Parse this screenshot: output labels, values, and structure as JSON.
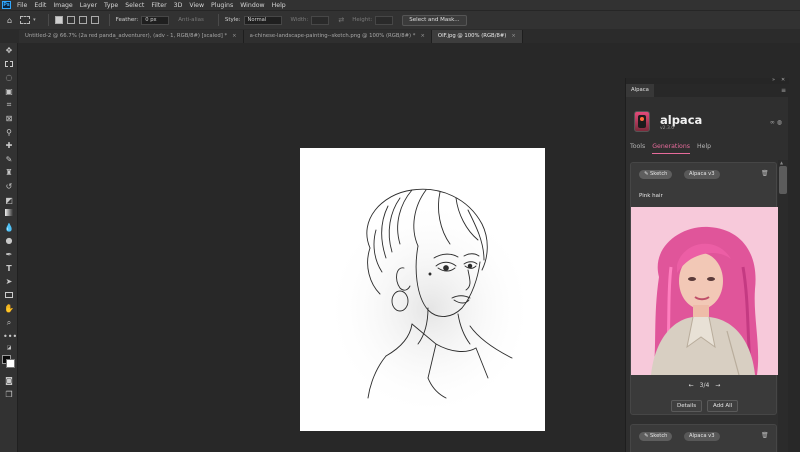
{
  "app_logo": "Ps",
  "menu": [
    "File",
    "Edit",
    "Image",
    "Layer",
    "Type",
    "Select",
    "Filter",
    "3D",
    "View",
    "Plugins",
    "Window",
    "Help"
  ],
  "options": {
    "feather_label": "Feather:",
    "feather_value": "0 px",
    "antialias_label": "Anti-alias",
    "style_label": "Style:",
    "style_value": "Normal",
    "width_label": "Width:",
    "height_label": "Height:",
    "select_mask_label": "Select and Mask..."
  },
  "tabs": [
    {
      "label": "Untitled-2 @ 66.7% (2a red panda_adventurer), (adv - 1, RGB/8#) [scaled] *",
      "active": false
    },
    {
      "label": "a-chinese-landscape-painting--sketch.png @ 100% (RGB/8#) *",
      "active": false
    },
    {
      "label": "OIF.jpg @ 100% (RGB/8#)",
      "active": true
    }
  ],
  "tab_close_glyph": "×",
  "colors": {
    "accent": "#e76b9b",
    "foreground_swatch": "#0a0a0a",
    "background_swatch": "#ffffff",
    "canvas": "#ffffff",
    "generated_background": "#f8c7d8"
  },
  "tools": [
    "move-icon",
    "marquee-icon",
    "lasso-icon",
    "object-select-icon",
    "crop-icon",
    "frame-icon",
    "eyedropper-icon",
    "healing-icon",
    "brush-icon",
    "stamp-icon",
    "history-brush-icon",
    "eraser-icon",
    "gradient-icon",
    "blur-icon",
    "dodge-icon",
    "pen-icon",
    "type-icon",
    "path-select-icon",
    "rectangle-icon",
    "hand-icon",
    "zoom-icon",
    "more-icon"
  ],
  "panel": {
    "tab_label": "Alpaca",
    "collapse_glyph": "»",
    "close_glyph": "✕",
    "app_name": "alpaca",
    "app_version": "v2.3.0",
    "nav": [
      "Tools",
      "Generations",
      "Help"
    ],
    "active_nav": "Generations",
    "cards": [
      {
        "chips": [
          "✎ Sketch",
          "Alpaca v3"
        ],
        "prompt": "Pink hair",
        "pager": "3/4",
        "prev_glyph": "←",
        "next_glyph": "→",
        "buttons": [
          "Details",
          "Add All"
        ]
      },
      {
        "chips": [
          "✎ Sketch",
          "Alpaca v3"
        ]
      }
    ]
  }
}
